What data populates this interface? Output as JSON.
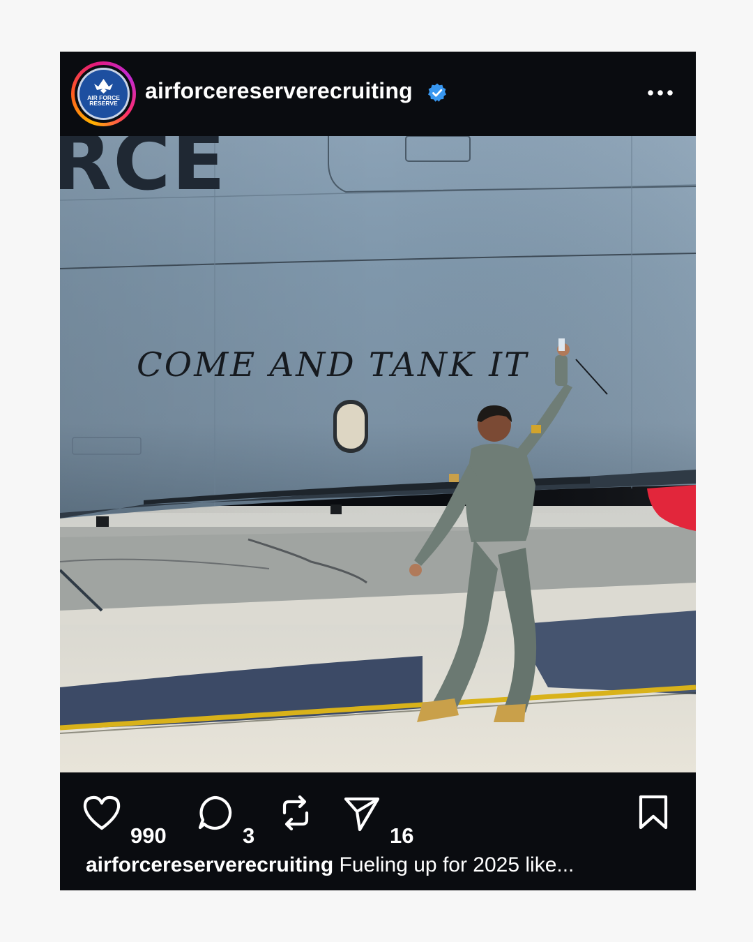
{
  "post": {
    "username": "airforcereserverecruiting",
    "verified": true,
    "avatar_text_line1": "AIR FORCE",
    "avatar_text_line2": "RESERVE",
    "photo": {
      "fuselage_lettering": "RCE",
      "handwriting": "COME AND TANK IT"
    },
    "likes": "990",
    "comments": "3",
    "shares": "16",
    "caption_user": "airforcereserverecruiting",
    "caption_text": " Fueling up for 2025 like..."
  },
  "colors": {
    "page_background": "#f7f7f7",
    "card_background": "#0a0c10",
    "verified_badge": "#3897f0",
    "avatar_blue": "#1d4fa0"
  },
  "icons": {
    "verified": "verified-badge-icon",
    "more": "more-options-icon",
    "like": "heart-icon",
    "comment": "comment-bubble-icon",
    "repost": "repost-icon",
    "share": "send-icon",
    "save": "bookmark-icon"
  }
}
